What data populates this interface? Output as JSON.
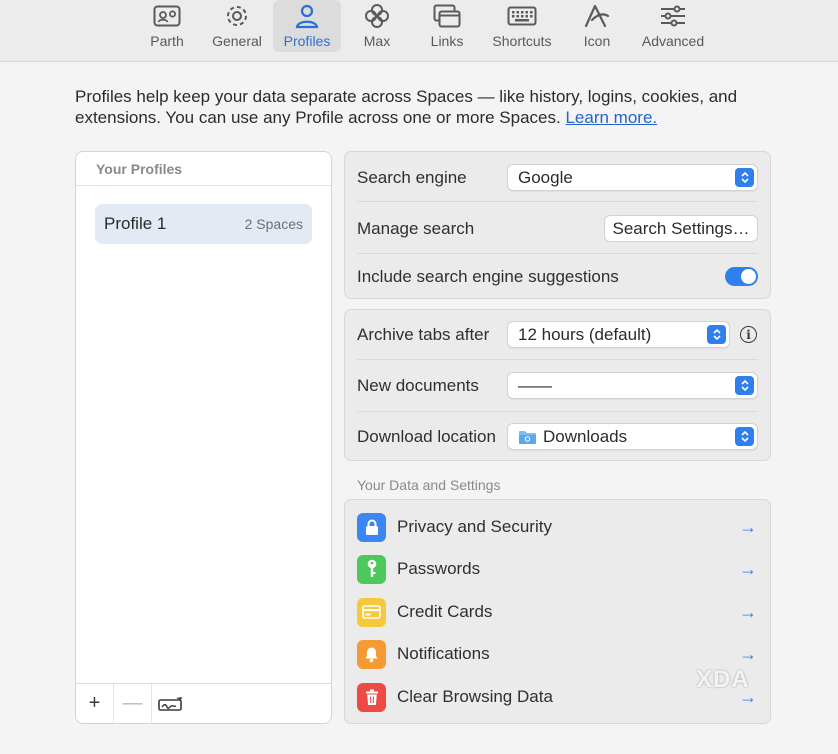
{
  "toolbar": {
    "items": [
      {
        "label": "Parth",
        "icon": "id-card-icon"
      },
      {
        "label": "General",
        "icon": "gear-icon"
      },
      {
        "label": "Profiles",
        "icon": "person-icon",
        "active": true
      },
      {
        "label": "Max",
        "icon": "max-flower-icon"
      },
      {
        "label": "Links",
        "icon": "windows-icon"
      },
      {
        "label": "Shortcuts",
        "icon": "keyboard-icon"
      },
      {
        "label": "Icon",
        "icon": "arc-logo-icon"
      },
      {
        "label": "Advanced",
        "icon": "sliders-icon"
      }
    ]
  },
  "intro": {
    "text": "Profiles help keep your data separate across Spaces — like history, logins, cookies, and extensions. You can use any Profile across one or more Spaces.",
    "link": "Learn more."
  },
  "profiles_panel": {
    "heading": "Your Profiles",
    "items": [
      {
        "name": "Profile 1",
        "spaces": "2 Spaces"
      }
    ],
    "footer": {
      "add": "+",
      "remove": "—"
    }
  },
  "search_box": {
    "engine_label": "Search engine",
    "engine_value": "Google",
    "manage_label": "Manage search",
    "manage_button": "Search Settings…",
    "suggestions_label": "Include search engine suggestions",
    "suggestions_on": true
  },
  "tabs_box": {
    "archive_label": "Archive tabs after",
    "archive_value": "12 hours (default)",
    "newdoc_label": "New documents",
    "newdoc_value": "——",
    "download_label": "Download location",
    "download_value": "Downloads"
  },
  "data_section": {
    "title": "Your Data and Settings",
    "items": [
      {
        "label": "Privacy and Security",
        "icon": "lock-icon",
        "color": "#3a86f2"
      },
      {
        "label": "Passwords",
        "icon": "key-icon",
        "color": "#4cc95a"
      },
      {
        "label": "Credit Cards",
        "icon": "credit-card-icon",
        "color": "#f5c93b"
      },
      {
        "label": "Notifications",
        "icon": "bell-icon",
        "color": "#f59b33"
      },
      {
        "label": "Clear Browsing Data",
        "icon": "trash-icon",
        "color": "#ee4a44"
      }
    ]
  },
  "colors": {
    "accent": "#2f80ed",
    "link": "#2563c9"
  },
  "watermark": "XDA"
}
